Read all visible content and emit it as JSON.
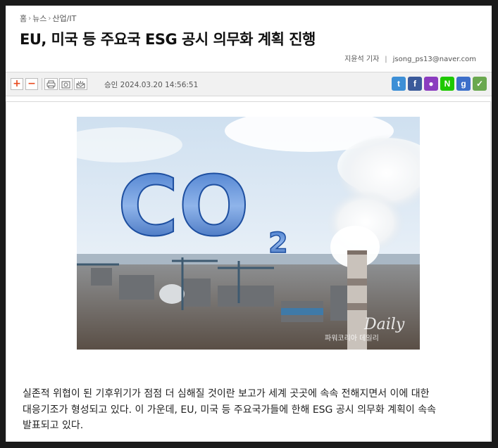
{
  "breadcrumb": {
    "home": "홈",
    "news": "뉴스",
    "category": "산업/IT"
  },
  "article": {
    "title": "EU, 미국 등 주요국 ESG 공시 의무화 계획 진행",
    "reporter": "지윤석 기자",
    "email": "jsong_ps13@naver.com",
    "approval": "승인 2024.03.20  14:56:51",
    "paragraph_lines": [
      "실존적 위협이 된 기후위기가 점점 더 심해질 것이란 보고가 세계 곳곳에 속속 전해지면서 이에 대한",
      "대응기조가 형성되고 있다. 이 가운데, EU, 미국 등 주요국가들에 한해 ESG 공시 의무화 계획이 속속",
      "발표되고 있다."
    ]
  },
  "toolbar": {
    "font_increase": "+",
    "font_decrease": "−",
    "icons": [
      "print-icon",
      "scrap-icon",
      "email-icon"
    ]
  },
  "image": {
    "big_text": "CO",
    "subscript": "2",
    "watermark_en": "Daily",
    "watermark_ko": "파워코리아 데일리"
  },
  "share": [
    {
      "name": "twitter-icon",
      "glyph": "t",
      "color": "#3d8fd6"
    },
    {
      "name": "facebook-icon",
      "glyph": "f",
      "color": "#3b5a9a"
    },
    {
      "name": "kakaostory-icon",
      "glyph": "●",
      "color": "#8b3cbf"
    },
    {
      "name": "naver-icon",
      "glyph": "N",
      "color": "#1ec800"
    },
    {
      "name": "googleplus-icon",
      "glyph": "g",
      "color": "#3d6fc9"
    },
    {
      "name": "band-icon",
      "glyph": "✓",
      "color": "#6aa84f"
    }
  ]
}
